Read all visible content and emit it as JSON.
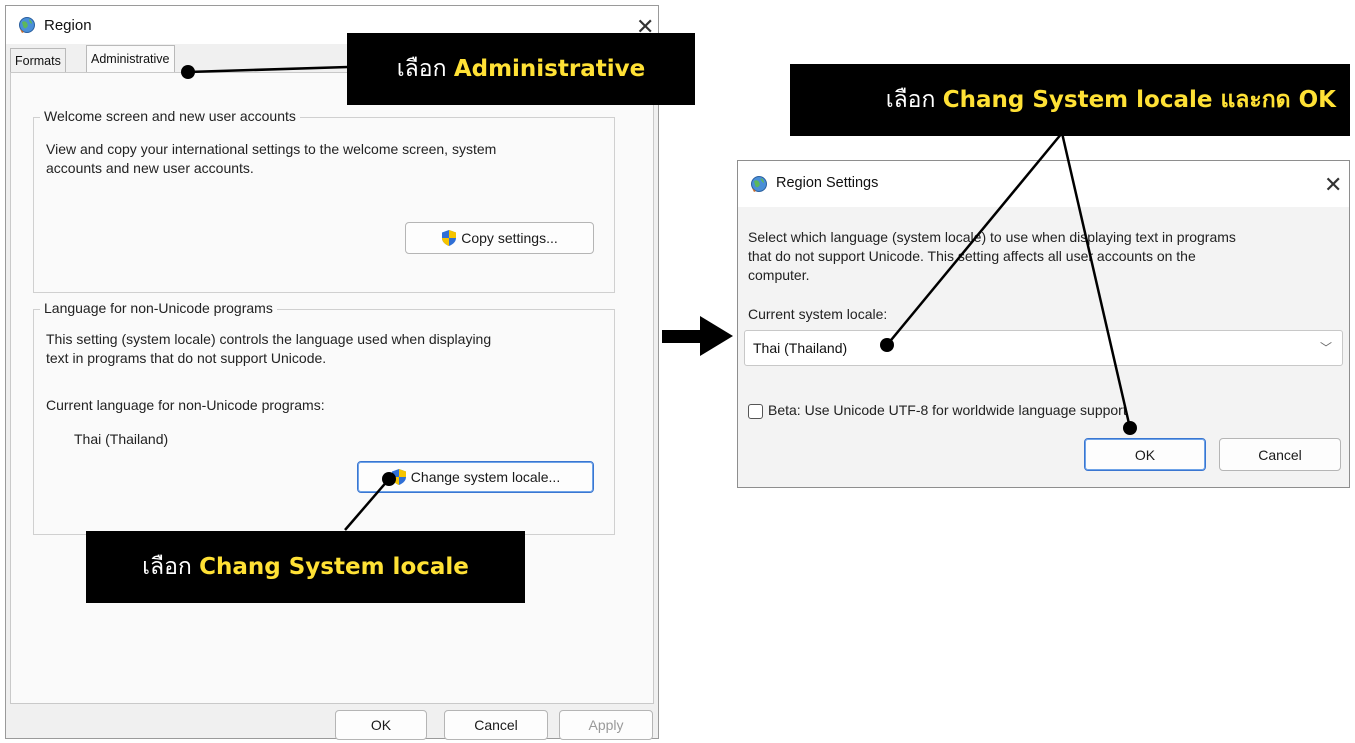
{
  "region_window": {
    "title": "Region",
    "tabs": [
      {
        "label": "Formats"
      },
      {
        "label": "Administrative"
      }
    ],
    "welcome_group": {
      "legend": "Welcome screen and new user accounts",
      "description_line1": "View and copy your international settings to the welcome screen, system",
      "description_line2": "accounts and new user accounts.",
      "copy_button": "Copy settings..."
    },
    "language_group": {
      "legend": "Language for non-Unicode programs",
      "description_line1": "This setting (system locale) controls the language used when displaying",
      "description_line2": "text in programs that do not support Unicode.",
      "current_label": "Current language for non-Unicode programs:",
      "current_value": "Thai (Thailand)",
      "change_button": "Change system locale..."
    },
    "buttons": {
      "ok": "OK",
      "cancel": "Cancel",
      "apply": "Apply"
    }
  },
  "region_settings_dialog": {
    "title": "Region Settings",
    "description_line1": "Select which language (system locale) to use when displaying text in programs",
    "description_line2": "that do not support Unicode. This setting affects all user accounts on the",
    "description_line3": "computer.",
    "locale_label": "Current system locale:",
    "locale_value": "Thai (Thailand)",
    "beta_checkbox": {
      "label": "Beta: Use Unicode UTF-8 for worldwide language support",
      "checked": false
    },
    "ok": "OK",
    "cancel": "Cancel"
  },
  "callouts": {
    "administrative": {
      "prefix": "เลือก",
      "highlight": "Administrative"
    },
    "change_locale": {
      "prefix": "เลือก",
      "highlight": "Chang System locale"
    },
    "change_and_ok": {
      "prefix": "เลือก",
      "highlight": "Chang System locale และกด OK"
    }
  },
  "colors": {
    "callout_bg": "#000000",
    "callout_highlight": "#ffe135",
    "focus_border": "#3a76d1"
  }
}
